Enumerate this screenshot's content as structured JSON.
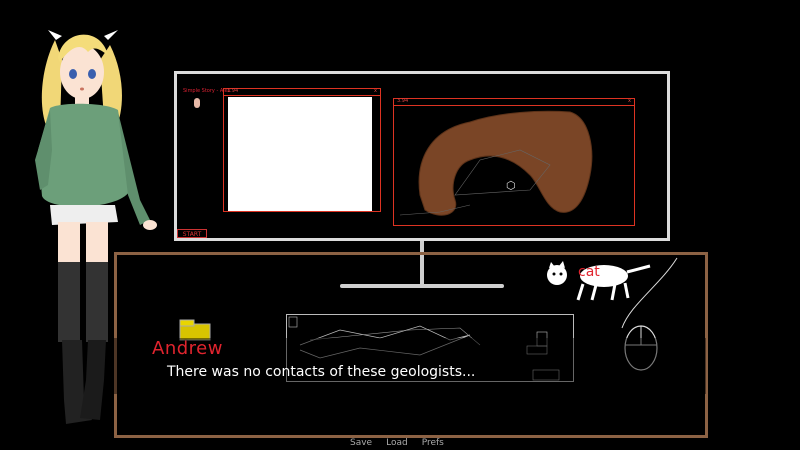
{
  "monitor": {
    "game_title": "Simple Story - Alex",
    "start_label": "START",
    "left_window": {
      "title": "1.94",
      "controls": "x"
    },
    "right_window": {
      "title": "3.94",
      "controls": "x"
    }
  },
  "desk": {
    "cat_label": "cat"
  },
  "dialogue": {
    "speaker": "Andrew",
    "text": "There was no contacts of these geologists..."
  },
  "quick_menu": {
    "save": "Save",
    "load": "Load",
    "prefs": "Prefs"
  },
  "colors": {
    "speaker": "#e0242e",
    "desk_outline": "#8c6244",
    "monitor_outline": "#dcdcdc",
    "blob": "#7a4526"
  }
}
